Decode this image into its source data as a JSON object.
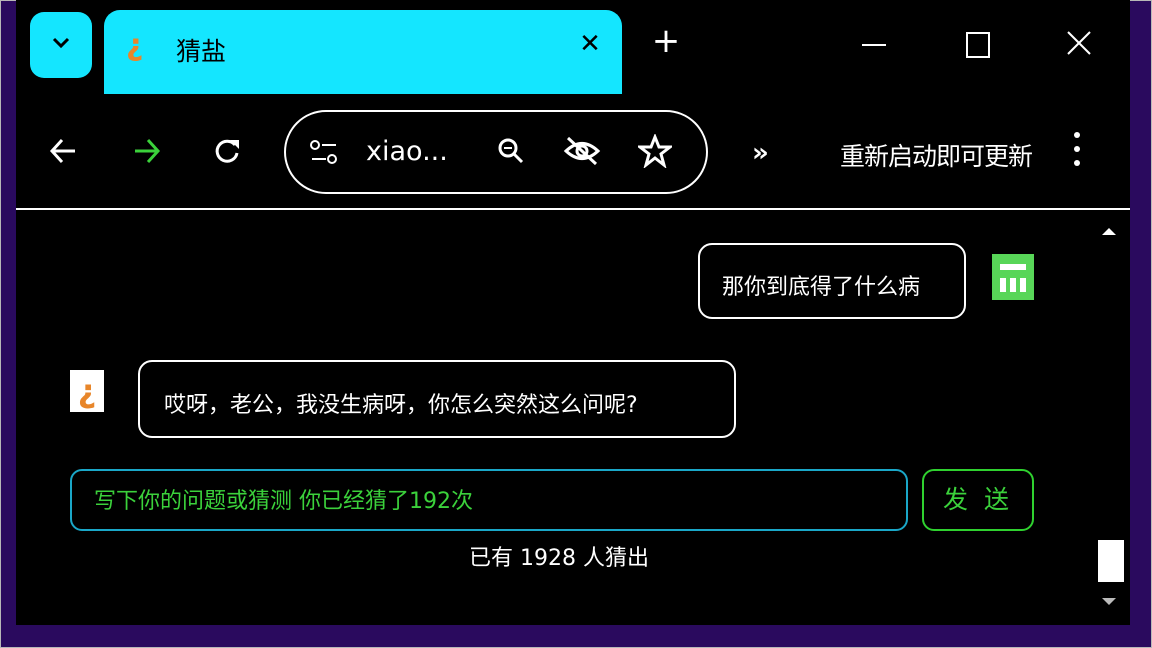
{
  "browser": {
    "tab": {
      "favicon": "¿",
      "title": "猜盐"
    },
    "new_tab": "+",
    "address": {
      "url": "xiao..."
    },
    "update_label": "重新启动即可更新",
    "more_tools": "»",
    "colors": {
      "tab_bg": "#14e6ff",
      "forward_arrow": "#3bd13b",
      "window_border": "#2a0a5e"
    }
  },
  "chat": {
    "messages": [
      {
        "role": "user",
        "text": "那你到底得了什么病"
      },
      {
        "role": "bot",
        "text": "哎呀，老公，我没生病呀，你怎么突然这么问呢?"
      }
    ],
    "bot_avatar": "¿",
    "input_placeholder": "写下你的问题或猜测 你已经猜了192次",
    "send_label": "发 送",
    "guessed_count": "已有 1928 人猜出"
  }
}
